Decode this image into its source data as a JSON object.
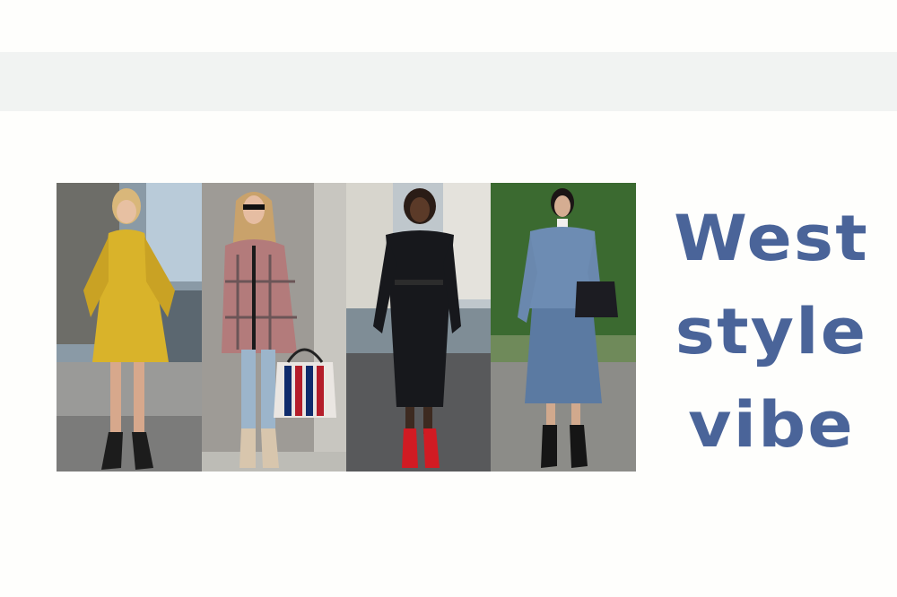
{
  "headline": {
    "line1": "West",
    "line2": "style",
    "line3": "vibe"
  },
  "colors": {
    "headline": "#4a6499",
    "band": "#f1f3f2",
    "background": "#fefefc"
  },
  "photos": [
    {
      "subject": "yellow-dress-outfit"
    },
    {
      "subject": "plaid-blazer-outfit"
    },
    {
      "subject": "black-knit-dress-outfit"
    },
    {
      "subject": "denim-outfit"
    }
  ]
}
